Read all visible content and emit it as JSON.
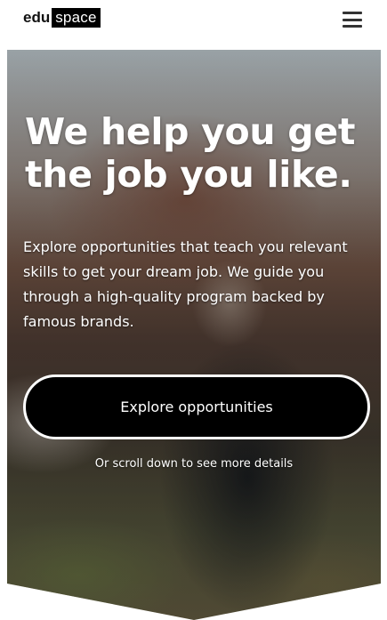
{
  "header": {
    "logo_part1": "edu",
    "logo_part2": "space",
    "menu_icon": "hamburger-menu-icon"
  },
  "hero": {
    "title": "We help you get the job you like.",
    "description": "Explore opportunities that teach you relevant skills to get your dream job. We guide you through a high-quality program backed by famous brands.",
    "cta_label": "Explore opportunities",
    "scroll_hint": "Or scroll down to see more details"
  },
  "colors": {
    "logo_box": "#000000",
    "cta_background": "#000000",
    "cta_border": "#ffffff",
    "hero_text": "#ffffff"
  }
}
